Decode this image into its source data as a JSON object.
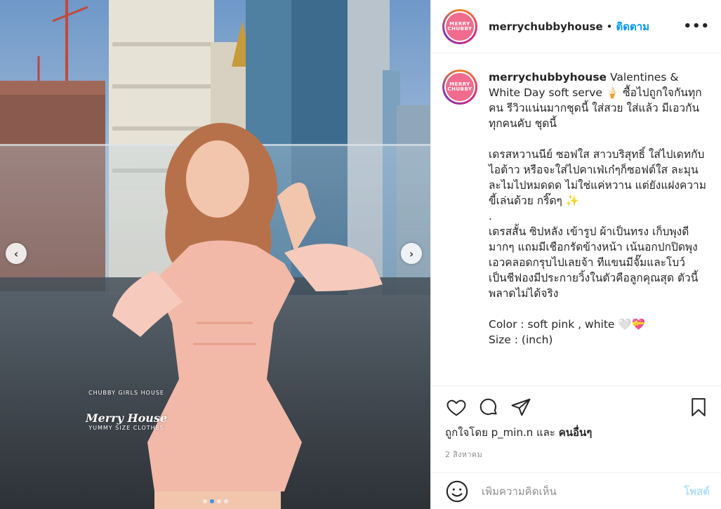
{
  "header": {
    "username": "merrychubbyhouse",
    "separator": "•",
    "follow_label": "ติดตาม",
    "more_icon": "more-horizontal-icon",
    "avatar_text_top": "MERRY",
    "avatar_text_bottom": "CHUBBY"
  },
  "caption": {
    "username": "merrychubbyhouse",
    "body": " Valentines & White Day soft serve 🍦 ซื้อไปถูกใจกันทุกคน รีวิวแน่นมากชุดนี้ ใส่สวย ใส่แล้ว มีเอวกันทุกคนคับ ชุดนี้\n\nเดรสหวานนีย์ ซอฟใส สาวบริสุทธิ์ ใส่ไปเดทกับไอต้าว หรือจะใส่ไปคาเฟ่เก๋ๆก็ซอฟต์ใส ละมุนละไมไปหมดดด ไม่ใช่แค่หวาน แต่ยังแฝงความขี้เล่นด้วย กริ๊ดๆ ✨\n.\nเดรสสั้น ซิปหลัง เข้ารูป ผ้าเป็นทรง เก็บพุงดีมากๆ แถมมีเชือกรัดข้างหน้า เน้นอกปกปิดพุงเอวคลอดกรุบไปเลยจ้า ทีแขนมีจั๊มและโบว์ เป็นชีฟองมีประกายวิ้งในตัวคือลูกคุณสุด ตัวนี้พลาดไม่ได้จริง\n\nColor : soft pink , white 🤍💝\nSize : (inch)"
  },
  "photo": {
    "watermark_top": "CHUBBY GIRLS HOUSE",
    "watermark_title": "Merry House",
    "watermark_bottom": "YUMMY SIZE CLOTHES",
    "prev_icon": "chevron-left-icon",
    "next_icon": "chevron-right-icon",
    "carousel_count": 4,
    "carousel_active": 1
  },
  "actions": {
    "like_icon": "heart-icon",
    "comment_icon": "comment-icon",
    "share_icon": "share-icon",
    "save_icon": "bookmark-icon",
    "likes_prefix": "ถูกใจโดย ",
    "likes_user": "p_min.n",
    "likes_and": " และ ",
    "likes_others": "คนอื่นๆ",
    "date": "2 สิงหาคม"
  },
  "comment": {
    "emoji_icon": "smiley-icon",
    "placeholder": "เพิ่มความคิดเห็น",
    "post_label": "โพสต์"
  },
  "colors": {
    "accent": "#0095f6",
    "post_disabled": "#b2dffc",
    "dress": "#f2b9a8",
    "avatar_bg": "#f06b8d"
  }
}
